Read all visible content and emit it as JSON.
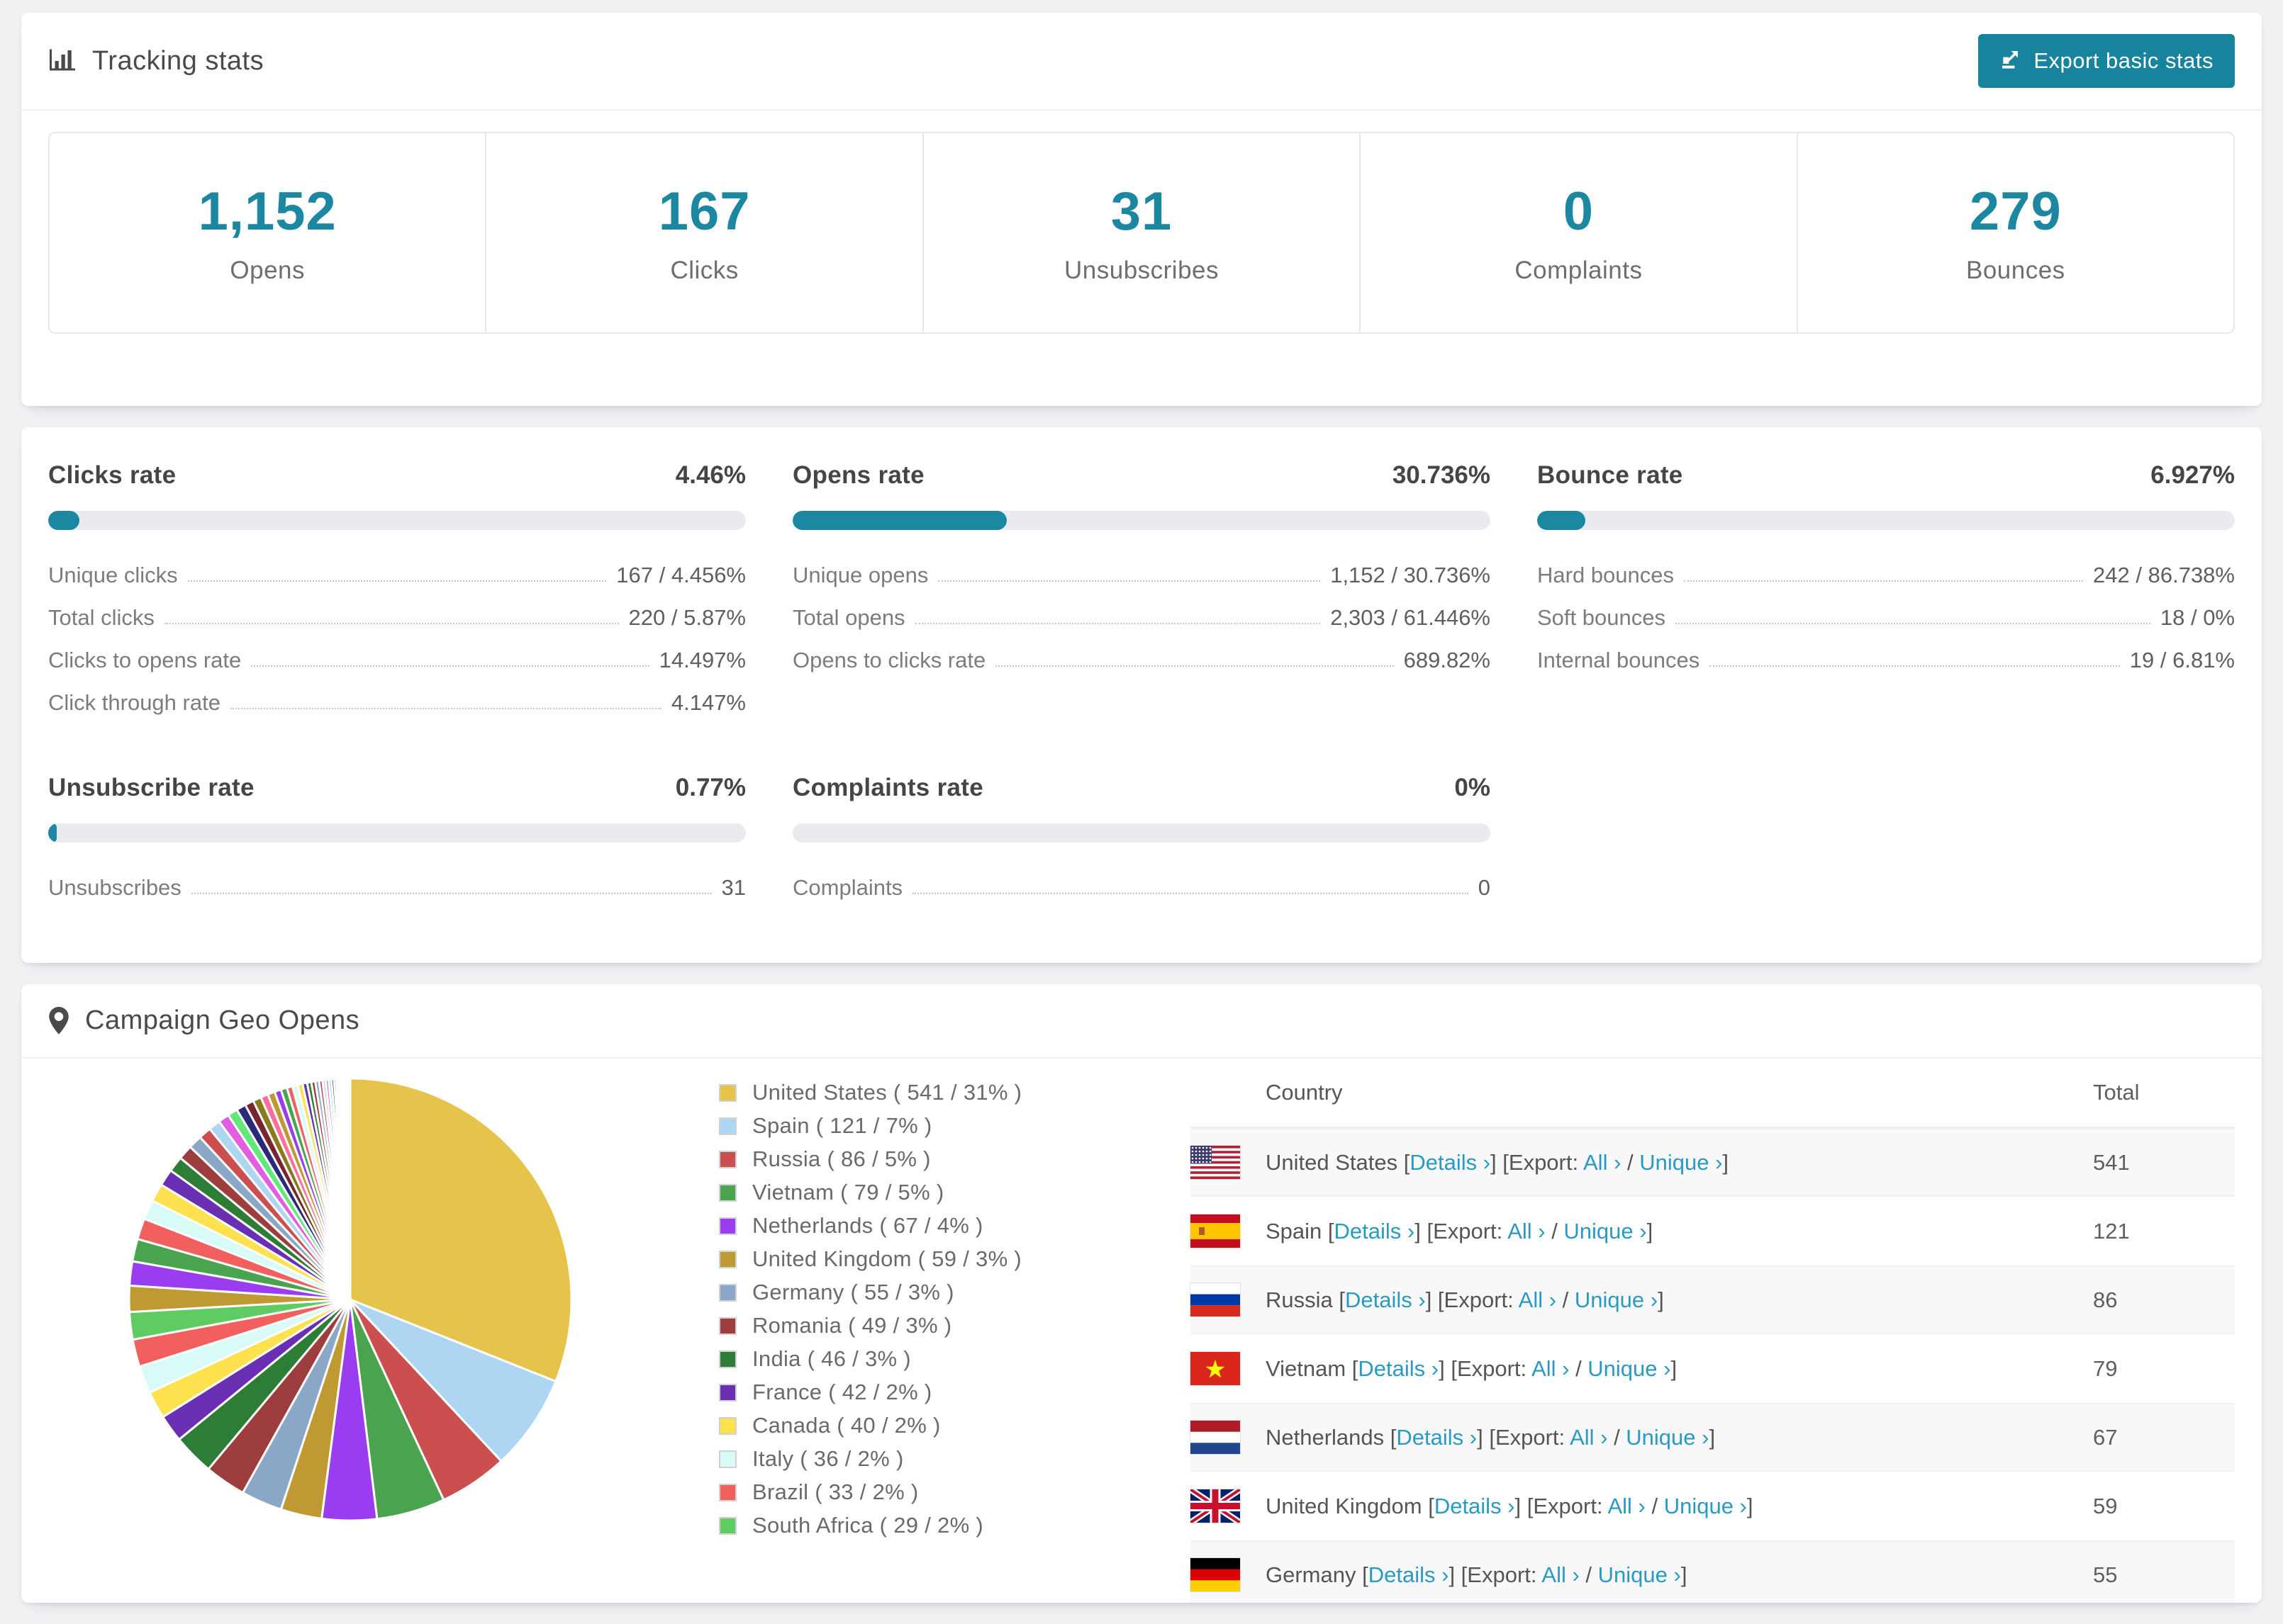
{
  "accent": "#1b87a0",
  "header": {
    "title": "Tracking stats",
    "export_label": "Export basic stats"
  },
  "summary_stats": [
    {
      "value": "1,152",
      "label": "Opens"
    },
    {
      "value": "167",
      "label": "Clicks"
    },
    {
      "value": "31",
      "label": "Unsubscribes"
    },
    {
      "value": "0",
      "label": "Complaints"
    },
    {
      "value": "279",
      "label": "Bounces"
    }
  ],
  "rate_blocks": [
    {
      "title": "Clicks rate",
      "value": "4.46%",
      "percent": 4.46,
      "rows": [
        {
          "label": "Unique clicks",
          "value": "167 / 4.456%"
        },
        {
          "label": "Total clicks",
          "value": "220 / 5.87%"
        },
        {
          "label": "Clicks to opens rate",
          "value": "14.497%"
        },
        {
          "label": "Click through rate",
          "value": "4.147%"
        }
      ]
    },
    {
      "title": "Opens rate",
      "value": "30.736%",
      "percent": 30.736,
      "rows": [
        {
          "label": "Unique opens",
          "value": "1,152 / 30.736%"
        },
        {
          "label": "Total opens",
          "value": "2,303 / 61.446%"
        },
        {
          "label": "Opens to clicks rate",
          "value": "689.82%"
        }
      ]
    },
    {
      "title": "Bounce rate",
      "value": "6.927%",
      "percent": 6.927,
      "rows": [
        {
          "label": "Hard bounces",
          "value": "242 / 86.738%"
        },
        {
          "label": "Soft bounces",
          "value": "18 / 0%"
        },
        {
          "label": "Internal bounces",
          "value": "19 / 6.81%"
        }
      ]
    },
    {
      "title": "Unsubscribe rate",
      "value": "0.77%",
      "percent": 0.77,
      "rows": [
        {
          "label": "Unsubscribes",
          "value": "31"
        }
      ]
    },
    {
      "title": "Complaints rate",
      "value": "0%",
      "percent": 0,
      "rows": [
        {
          "label": "Complaints",
          "value": "0"
        }
      ]
    }
  ],
  "geo": {
    "title": "Campaign Geo Opens",
    "table": {
      "col_country": "Country",
      "col_total": "Total",
      "links": {
        "details": "Details ›",
        "export": "Export:",
        "all": "All ›",
        "slash": "/",
        "unique": "Unique ›"
      },
      "rows": [
        {
          "flag": "us",
          "country": "United States",
          "total": "541"
        },
        {
          "flag": "es",
          "country": "Spain",
          "total": "121"
        },
        {
          "flag": "ru",
          "country": "Russia",
          "total": "86"
        },
        {
          "flag": "vn",
          "country": "Vietnam",
          "total": "79"
        },
        {
          "flag": "nl",
          "country": "Netherlands",
          "total": "67"
        },
        {
          "flag": "gb",
          "country": "United Kingdom",
          "total": "59"
        },
        {
          "flag": "de",
          "country": "Germany",
          "total": "55",
          "partial": true
        }
      ]
    }
  },
  "chart_data": {
    "type": "pie",
    "title": "Campaign Geo Opens",
    "unit": "opens",
    "start_angle_deg": -90,
    "direction": "clockwise",
    "legend_position": "right",
    "slices": [
      {
        "label": "United States",
        "count": 541,
        "percent": 31,
        "color": "#e6c34a"
      },
      {
        "label": "Spain",
        "count": 121,
        "percent": 7,
        "color": "#aed5f2"
      },
      {
        "label": "Russia",
        "count": 86,
        "percent": 5,
        "color": "#cc4f4f"
      },
      {
        "label": "Vietnam",
        "count": 79,
        "percent": 5,
        "color": "#4aa34e"
      },
      {
        "label": "Netherlands",
        "count": 67,
        "percent": 4,
        "color": "#9a3df0"
      },
      {
        "label": "United Kingdom",
        "count": 59,
        "percent": 3,
        "color": "#bf9a33"
      },
      {
        "label": "Germany",
        "count": 55,
        "percent": 3,
        "color": "#8ba7c7"
      },
      {
        "label": "Romania",
        "count": 49,
        "percent": 3,
        "color": "#9e3d3d"
      },
      {
        "label": "India",
        "count": 46,
        "percent": 3,
        "color": "#2e7d36"
      },
      {
        "label": "France",
        "count": 42,
        "percent": 2,
        "color": "#6b2fb3"
      },
      {
        "label": "Canada",
        "count": 40,
        "percent": 2,
        "color": "#fde14e"
      },
      {
        "label": "Italy",
        "count": 36,
        "percent": 2,
        "color": "#d9fbf7"
      },
      {
        "label": "Brazil",
        "count": 33,
        "percent": 2,
        "color": "#f25f5f"
      },
      {
        "label": "South Africa",
        "count": 29,
        "percent": 2,
        "color": "#5ecb63"
      }
    ],
    "others_unlabeled_percents": [
      1.9,
      1.77,
      1.64,
      1.53,
      1.42,
      1.32,
      1.23,
      1.14,
      1.06,
      0.99,
      0.92,
      0.86,
      0.8,
      0.74,
      0.69,
      0.64,
      0.6,
      0.55,
      0.52,
      0.48,
      0.45,
      0.41,
      0.39,
      0.36,
      0.33,
      0.31,
      0.29,
      0.27,
      0.25,
      0.23,
      0.22,
      0.2,
      0.19,
      0.17,
      0.16,
      0.15,
      0.14,
      0.13,
      0.12,
      0.11,
      0.1,
      0.09
    ]
  }
}
